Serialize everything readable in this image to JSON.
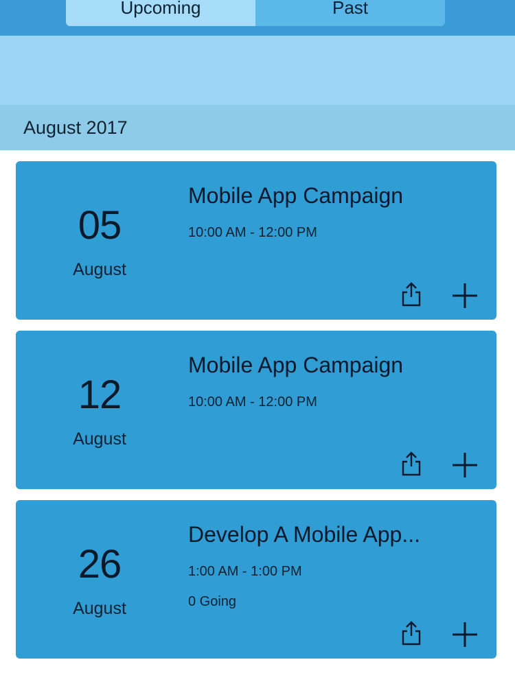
{
  "tabs": [
    {
      "label": "Upcoming",
      "active": true
    },
    {
      "label": "Past",
      "active": false
    }
  ],
  "section": {
    "title": "August 2017"
  },
  "events": [
    {
      "day": "05",
      "month": "August",
      "title": "Mobile App Campaign",
      "time": "10:00 AM - 12:00 PM",
      "going": "",
      "share_icon": "share-icon",
      "add_icon": "plus-icon"
    },
    {
      "day": "12",
      "month": "August",
      "title": "Mobile App Campaign",
      "time": "10:00 AM - 12:00 PM",
      "going": "",
      "share_icon": "share-icon",
      "add_icon": "plus-icon"
    },
    {
      "day": "26",
      "month": "August",
      "title": "Develop A Mobile App...",
      "time": "1:00 AM - 1:00 PM",
      "going": "0 Going",
      "share_icon": "share-icon",
      "add_icon": "plus-icon"
    }
  ],
  "colors": {
    "header": "#3a9bd6",
    "tab_active": "#a6dcf7",
    "tab_inactive": "#5cb8e9",
    "band": "#9bd6f6",
    "section_header": "#8ecbe9",
    "card": "#309dd4"
  }
}
